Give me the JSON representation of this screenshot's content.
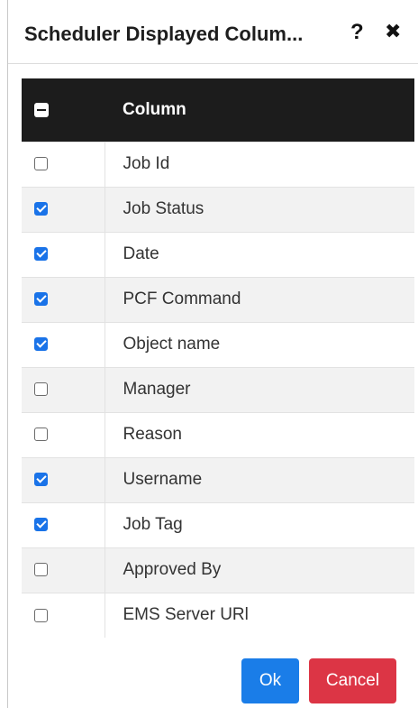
{
  "dialog": {
    "title": "Scheduler Displayed Colum...",
    "help_icon": "?",
    "close_icon": "✖"
  },
  "table": {
    "header_label": "Column",
    "select_all_state": "indeterminate",
    "rows": [
      {
        "label": "Job Id",
        "checked": false
      },
      {
        "label": "Job Status",
        "checked": true
      },
      {
        "label": "Date",
        "checked": true
      },
      {
        "label": "PCF Command",
        "checked": true
      },
      {
        "label": "Object name",
        "checked": true
      },
      {
        "label": "Manager",
        "checked": false
      },
      {
        "label": "Reason",
        "checked": false
      },
      {
        "label": "Username",
        "checked": true
      },
      {
        "label": "Job Tag",
        "checked": true
      },
      {
        "label": "Approved By",
        "checked": false
      },
      {
        "label": "EMS Server URl",
        "checked": false
      }
    ]
  },
  "buttons": {
    "ok_label": "Ok",
    "cancel_label": "Cancel"
  },
  "colors": {
    "header_bg": "#1c1c1c",
    "checkbox_checked": "#1a73e8",
    "ok_button": "#1a7de8",
    "cancel_button": "#dc3545"
  }
}
